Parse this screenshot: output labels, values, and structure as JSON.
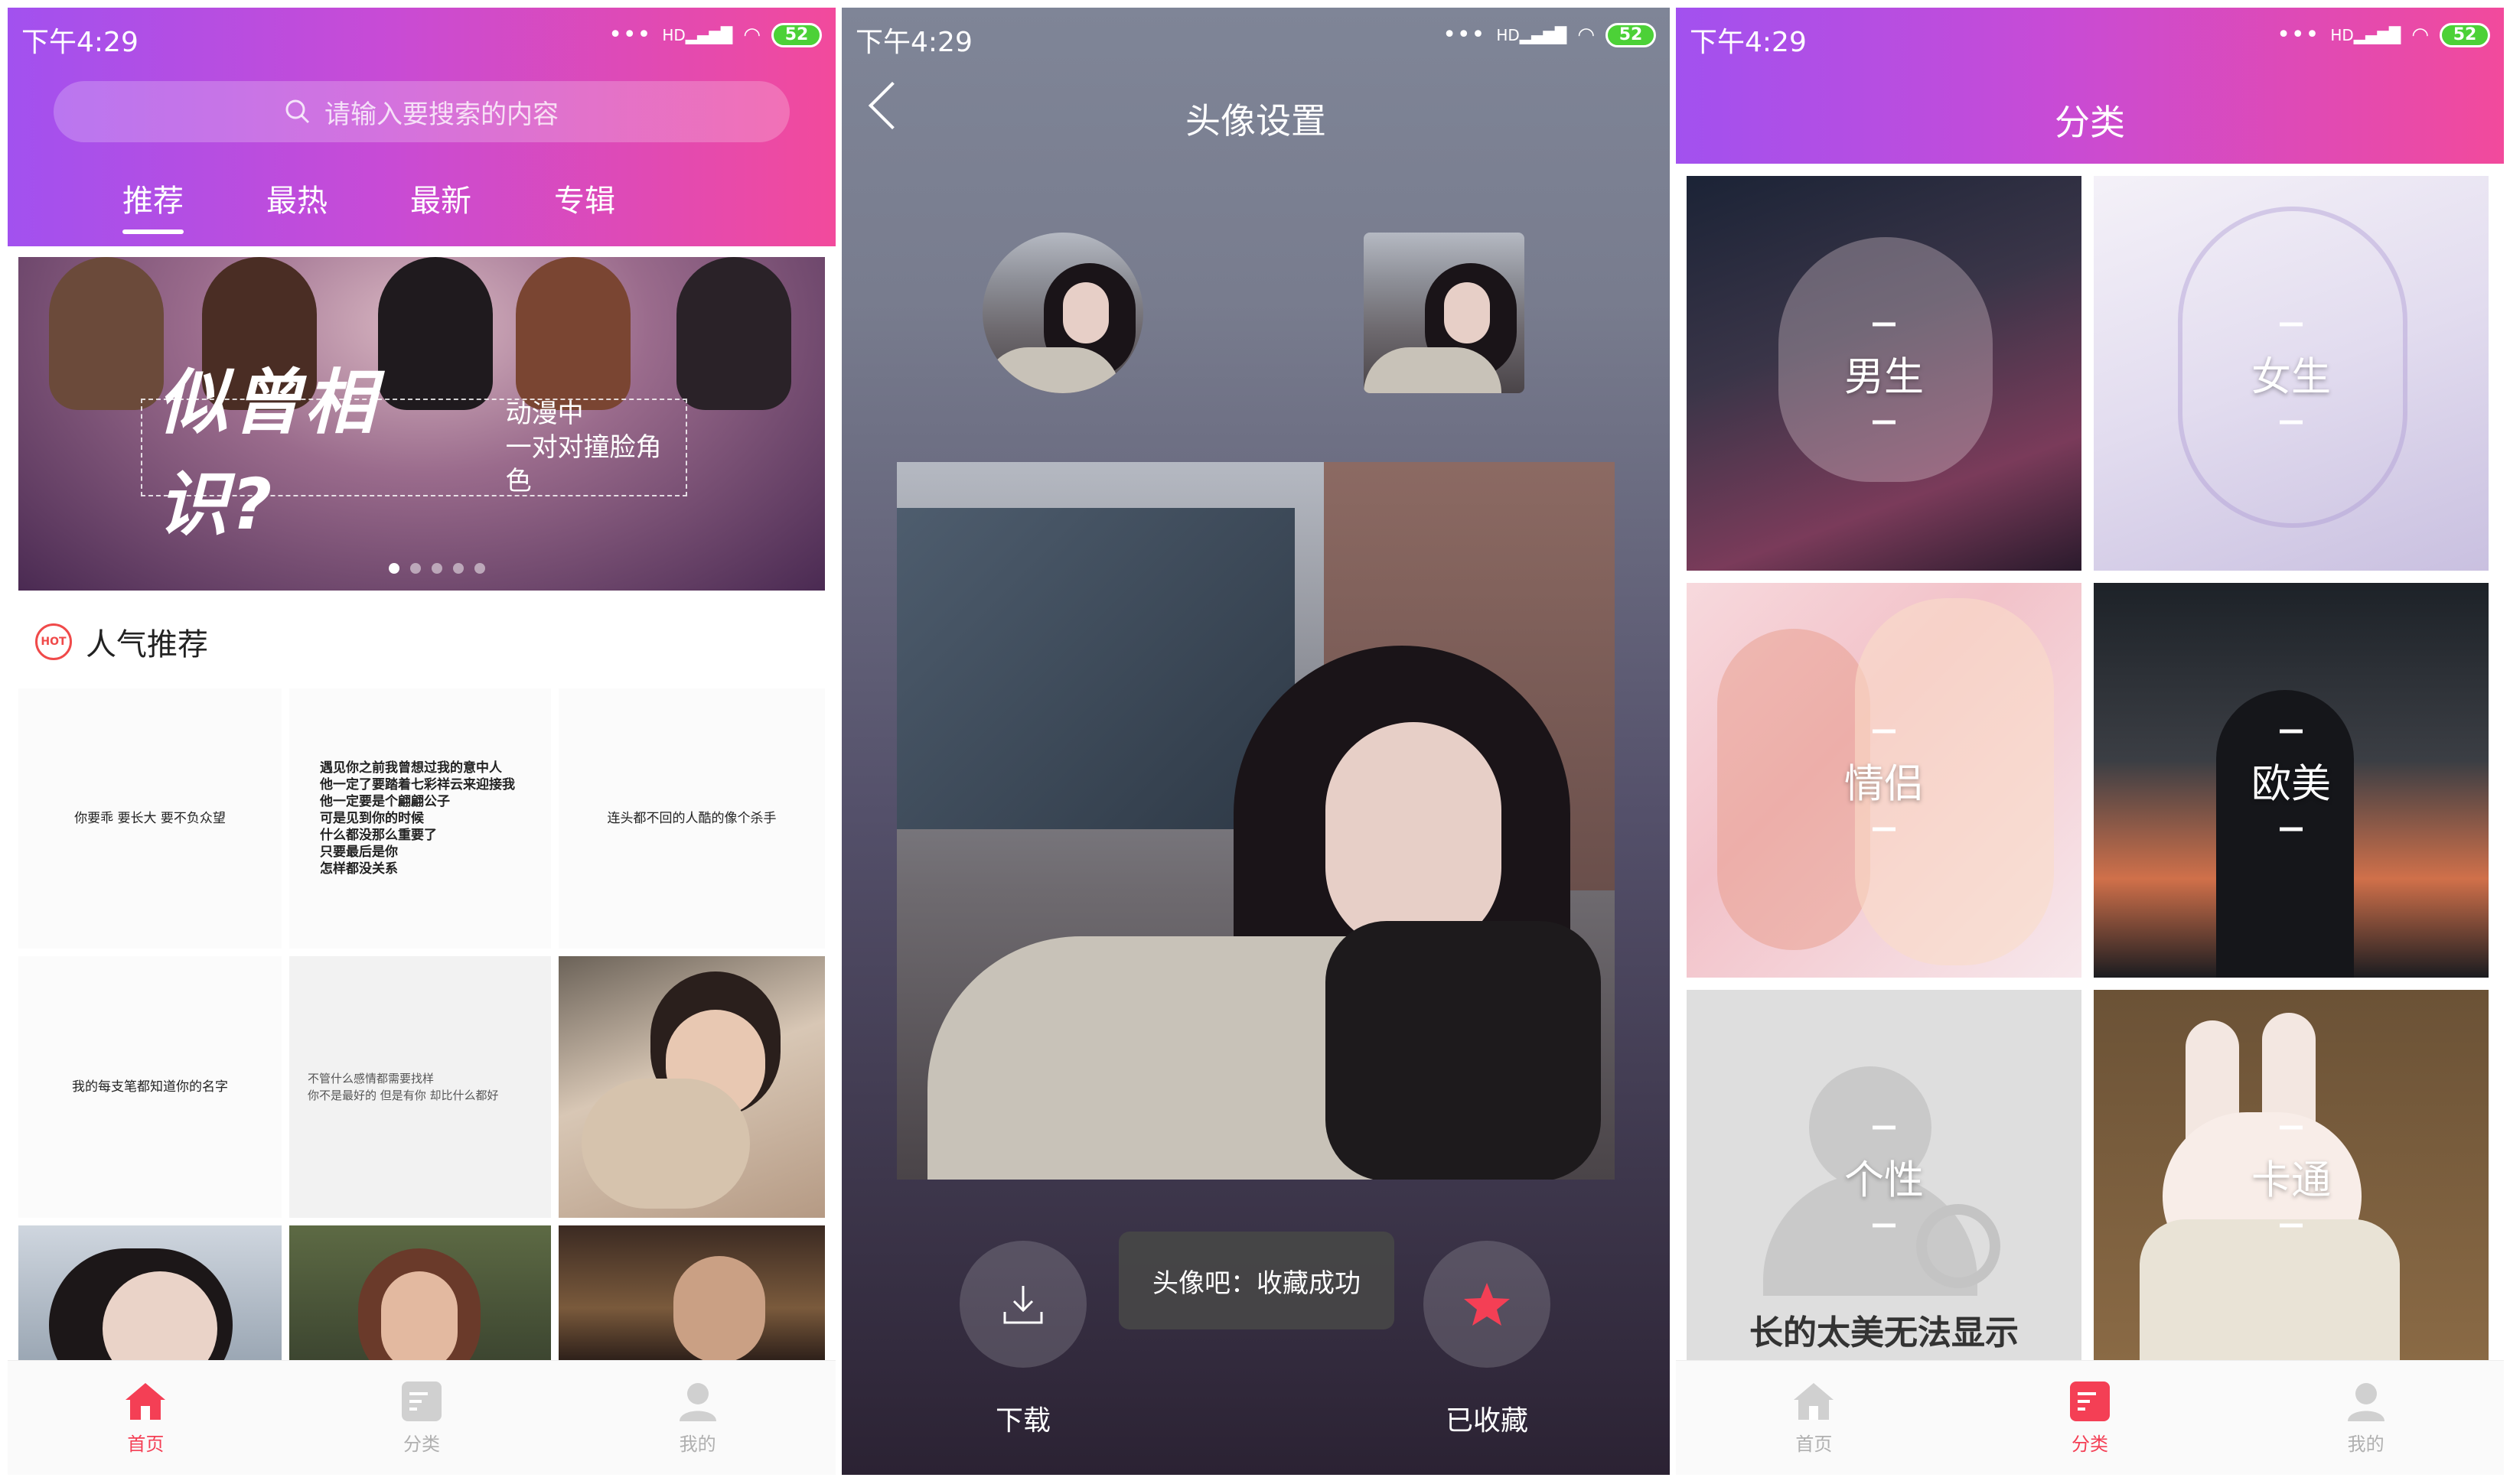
{
  "status_bar": {
    "time": "下午4:29",
    "battery": "52",
    "signal_label": "HD"
  },
  "home": {
    "search_placeholder": "请输入要搜索的内容",
    "tabs": [
      {
        "label": "推荐"
      },
      {
        "label": "最热"
      },
      {
        "label": "最新"
      },
      {
        "label": "专辑"
      }
    ],
    "banner": {
      "title": "似曾相识?",
      "subtitle_line1": "动漫中",
      "subtitle_line2": "一对对撞脸角色",
      "slide_count": 5,
      "active_slide": 1
    },
    "hot_icon_text": "HOT",
    "section_title": "人气推荐",
    "tiles": [
      {
        "text": "你要乖 要长大 要不负众望"
      },
      {
        "text": "遇见你之前我曾想过我的意中人\n他一定了要踏着七彩祥云来迎接我\n他一定要是个翩翩公子\n可是见到你的时候\n什么都没那么重要了\n只要最后是你\n怎样都没关系"
      },
      {
        "text": "连头都不回的人酷的像个杀手"
      },
      {
        "text": "我的每支笔都知道你的名字"
      },
      {
        "text": "不管什么感情都需要找样\n你不是最好的 但是有你 却比什么都好"
      }
    ]
  },
  "detail": {
    "title": "头像设置",
    "download_label": "下载",
    "favorite_label": "已收藏",
    "toast": "头像吧：收藏成功"
  },
  "category": {
    "title": "分类",
    "items": [
      {
        "label": "男生"
      },
      {
        "label": "女生"
      },
      {
        "label": "情侣"
      },
      {
        "label": "欧美"
      },
      {
        "label": "个性"
      },
      {
        "label": "卡通"
      }
    ],
    "unavailable_text": "长的太美无法显示"
  },
  "tabbar": {
    "home": "首页",
    "category": "分类",
    "mine": "我的"
  },
  "colors": {
    "gradient_start": "#a251ef",
    "gradient_end": "#f24a9c",
    "accent": "#f43f55"
  }
}
